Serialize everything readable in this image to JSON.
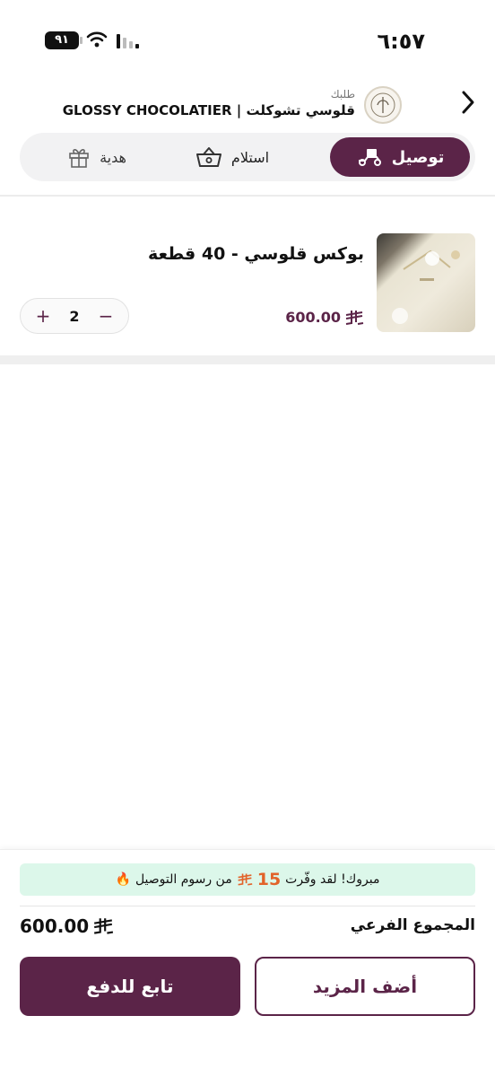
{
  "status_bar": {
    "time": "٦:٥٧",
    "battery": "٩١"
  },
  "header": {
    "order_label": "طلبك",
    "store_name": "قلوسي تشوكلت | GLOSSY CHOCOLATIER",
    "logo_icon": "store-logo-icon",
    "back_icon": "chevron-right-icon"
  },
  "tabs": [
    {
      "label": "توصيل",
      "icon": "delivery-scooter-icon",
      "active": true
    },
    {
      "label": "استلام",
      "icon": "basket-icon",
      "active": false
    },
    {
      "label": "هدية",
      "icon": "gift-icon",
      "active": false
    }
  ],
  "cart": {
    "items": [
      {
        "name": "بوكس قلوسي - 40 قطعة",
        "price": "600.00",
        "quantity": "2"
      }
    ]
  },
  "footer": {
    "promo": {
      "prefix": "مبروك! لقد وفّرت",
      "amount": "15",
      "suffix": "من رسوم التوصيل",
      "emoji": "🔥"
    },
    "subtotal_label": "المجموع الفرعي",
    "subtotal_value": "600.00",
    "add_more_label": "أضف المزيد",
    "checkout_label": "تابع للدفع"
  },
  "colors": {
    "brand": "#5b2448",
    "promo_bg": "#dcf7ea",
    "promo_accent": "#e2632a"
  }
}
